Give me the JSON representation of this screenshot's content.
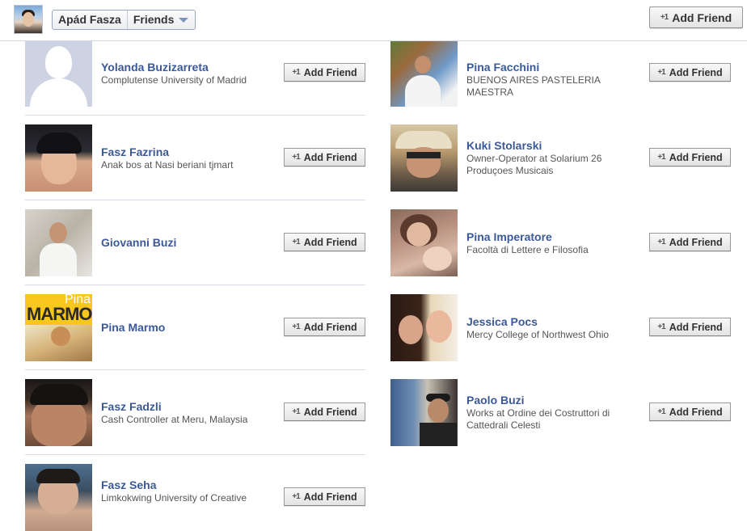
{
  "header": {
    "profile_name": "Apád Fasza",
    "section": "Friends",
    "add_friend_label": "Add Friend"
  },
  "friends": [
    {
      "name": "Yolanda Buzizarreta",
      "sub": "Complutense University of Madrid",
      "button": "Add Friend"
    },
    {
      "name": "Pina Facchini",
      "sub": "BUENOS AIRES PASTELERIA MAESTRA",
      "button": "Add Friend"
    },
    {
      "name": "Fasz Fazrina",
      "sub": "Anak bos at Nasi beriani tjmart",
      "button": "Add Friend"
    },
    {
      "name": "Kuki Stolarski",
      "sub": "Owner-Operator at Solarium 26 Produçoes Musicais",
      "button": "Add Friend"
    },
    {
      "name": "Giovanni Buzi",
      "sub": "",
      "button": "Add Friend"
    },
    {
      "name": "Pina Imperatore",
      "sub": "Facoltà di Lettere e Filosofia",
      "button": "Add Friend"
    },
    {
      "name": "Pina Marmo",
      "sub": "",
      "button": "Add Friend"
    },
    {
      "name": "Jessica Pocs",
      "sub": "Mercy College of Northwest Ohio",
      "button": "Add Friend"
    },
    {
      "name": "Fasz Fadzli",
      "sub": "Cash Controller at Meru, Malaysia",
      "button": "Add Friend"
    },
    {
      "name": "Paolo Buzi",
      "sub": "Works at Ordine dei Costruttori di Cattedrali Celesti",
      "button": "Add Friend"
    },
    {
      "name": "Fasz Seha",
      "sub": "Limkokwing University of Creative",
      "button": "Add Friend"
    }
  ],
  "photo_text": {
    "pina_marmo_line1": "Pina",
    "pina_marmo_line2": "MARMO"
  },
  "colors": {
    "link_blue": "#3b5998",
    "divider": "#d8dce6",
    "placeholder_bg": "#cdd3e3"
  }
}
